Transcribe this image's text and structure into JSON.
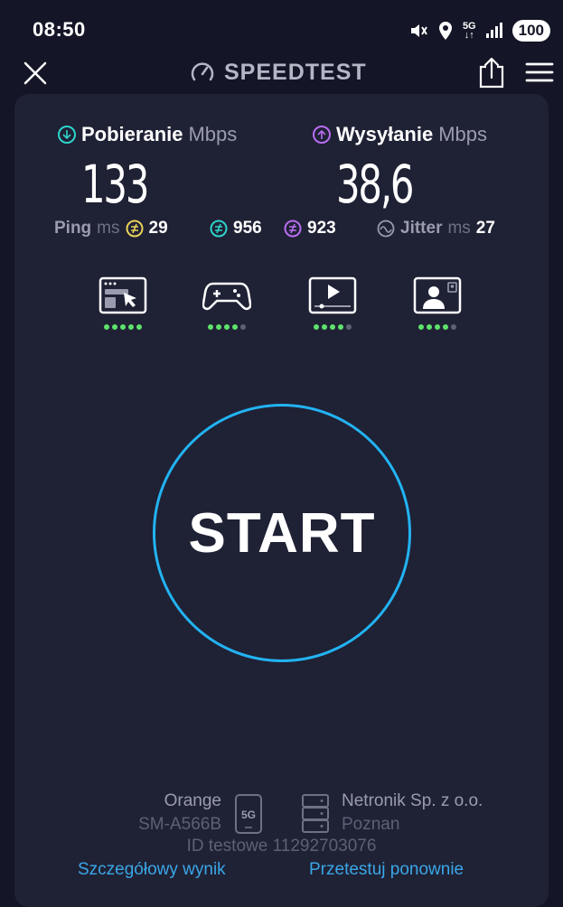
{
  "status": {
    "time": "08:50",
    "network": "5G",
    "battery": "100"
  },
  "header": {
    "title": "SPEEDTEST"
  },
  "download": {
    "label": "Pobieranie",
    "unit": "Mbps",
    "value": "133",
    "color": "#2ed3c8"
  },
  "upload": {
    "label": "Wysyłanie",
    "unit": "Mbps",
    "value": "38,6",
    "color": "#b86ef0"
  },
  "ping": {
    "label": "Ping",
    "unit": "ms",
    "idle": "29",
    "download": "956",
    "upload": "923"
  },
  "jitter": {
    "label": "Jitter",
    "unit": "ms",
    "value": "27"
  },
  "quality": [
    {
      "icon": "browsing-icon",
      "level": 5
    },
    {
      "icon": "gaming-icon",
      "level": 4
    },
    {
      "icon": "video-streaming-icon",
      "level": 4
    },
    {
      "icon": "video-call-icon",
      "level": 4
    }
  ],
  "start": {
    "label": "START",
    "ring_color": "#22b3f2"
  },
  "provider": {
    "carrier": "Orange",
    "device": "SM-A566B",
    "badge": "5G",
    "server_name": "Netronik Sp. z o.o.",
    "server_city": "Poznan"
  },
  "test_id": "ID testowe 11292703076",
  "links": {
    "details": "Szczegółowy wynik",
    "retest": "Przetestuj ponownie"
  }
}
